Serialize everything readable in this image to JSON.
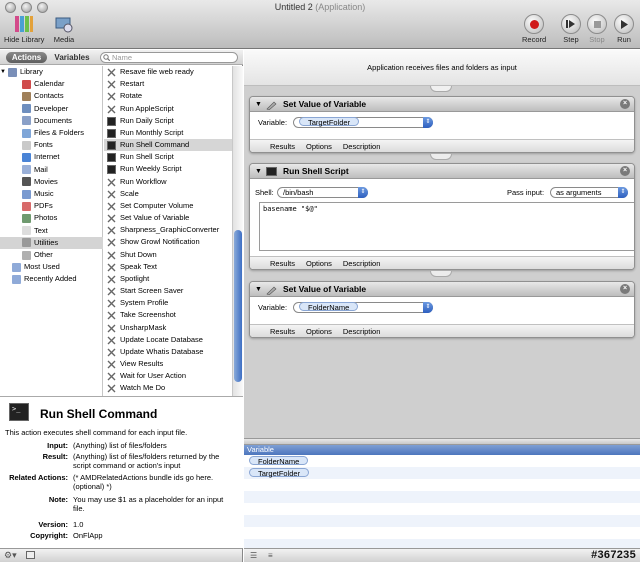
{
  "window": {
    "title": "Untitled 2",
    "title_suffix": "(Application)"
  },
  "toolbar": {
    "hide_library": "Hide Library",
    "media": "Media",
    "record": "Record",
    "step": "Step",
    "stop": "Stop",
    "run": "Run"
  },
  "library_tabs": {
    "actions": "Actions",
    "variables": "Variables",
    "search_placeholder": "Name"
  },
  "library": [
    {
      "label": "Library",
      "color": "#7a8fb8"
    },
    {
      "label": "Calendar",
      "color": "#d04c4c"
    },
    {
      "label": "Contacts",
      "color": "#a0805a"
    },
    {
      "label": "Developer",
      "color": "#6f8fbf"
    },
    {
      "label": "Documents",
      "color": "#8aa0c8"
    },
    {
      "label": "Files & Folders",
      "color": "#7fa6d8"
    },
    {
      "label": "Fonts",
      "color": "#c9c9c9"
    },
    {
      "label": "Internet",
      "color": "#4a84d6"
    },
    {
      "label": "Mail",
      "color": "#9ab0d8"
    },
    {
      "label": "Movies",
      "color": "#555555"
    },
    {
      "label": "Music",
      "color": "#7a9ad0"
    },
    {
      "label": "PDFs",
      "color": "#d86a6a"
    },
    {
      "label": "Photos",
      "color": "#6f9a6f"
    },
    {
      "label": "Text",
      "color": "#dddddd"
    },
    {
      "label": "Utilities",
      "color": "#999999"
    },
    {
      "label": "Other",
      "color": "#b0b0b0"
    },
    {
      "label": "Most Used",
      "color": "#8faad8"
    },
    {
      "label": "Recently Added",
      "color": "#8faad8"
    }
  ],
  "actions": [
    "Resave file web ready",
    "Restart",
    "Rotate",
    "Run AppleScript",
    "Run Daily Script",
    "Run Monthly Script",
    "Run Shell Command",
    "Run Shell Script",
    "Run Weekly Script",
    "Run Workflow",
    "Scale",
    "Set Computer Volume",
    "Set Value of Variable",
    "Sharpness_GraphicConverter",
    "Show Growl Notification",
    "Shut Down",
    "Speak Text",
    "Spotlight",
    "Start Screen Saver",
    "System Profile",
    "Take Screenshot",
    "UnsharpMask",
    "Update Locate Database",
    "Update Whatis Database",
    "View Results",
    "Wait for User Action",
    "Watch Me Do"
  ],
  "description": {
    "title": "Run Shell Command",
    "summary": "This action executes shell command for each input file.",
    "rows": [
      {
        "key": "Input:",
        "value": "(Anything) list of files/folders"
      },
      {
        "key": "Result:",
        "value": "(Anything) list of files/folders returned by the script command or action's input"
      },
      {
        "key": "Related Actions:",
        "value": "(* AMDRelatedActions bundle ids go here. (optional) *)"
      },
      {
        "key": "Note:",
        "value": "You may use $1 as a placeholder for an input file."
      },
      {
        "key": "Version:",
        "value": "1.0"
      },
      {
        "key": "Copyright:",
        "value": "OnFlApp"
      }
    ]
  },
  "workflow": {
    "input_message": "Application receives files and folders as input",
    "footer_tabs": {
      "results": "Results",
      "options": "Options",
      "description": "Description"
    },
    "card1": {
      "title": "Set Value of Variable",
      "field_label": "Variable:",
      "value": "TargetFolder"
    },
    "card2": {
      "title": "Run Shell Script",
      "shell_label": "Shell:",
      "shell": "/bin/bash",
      "pass_label": "Pass input:",
      "pass": "as arguments",
      "script": "basename \"$@\""
    },
    "card3": {
      "title": "Set Value of Variable",
      "field_label": "Variable:",
      "value": "FolderName"
    }
  },
  "variables": {
    "header": "Variable",
    "items": [
      "FolderName",
      "TargetFolder"
    ]
  },
  "watermark": "#367235"
}
